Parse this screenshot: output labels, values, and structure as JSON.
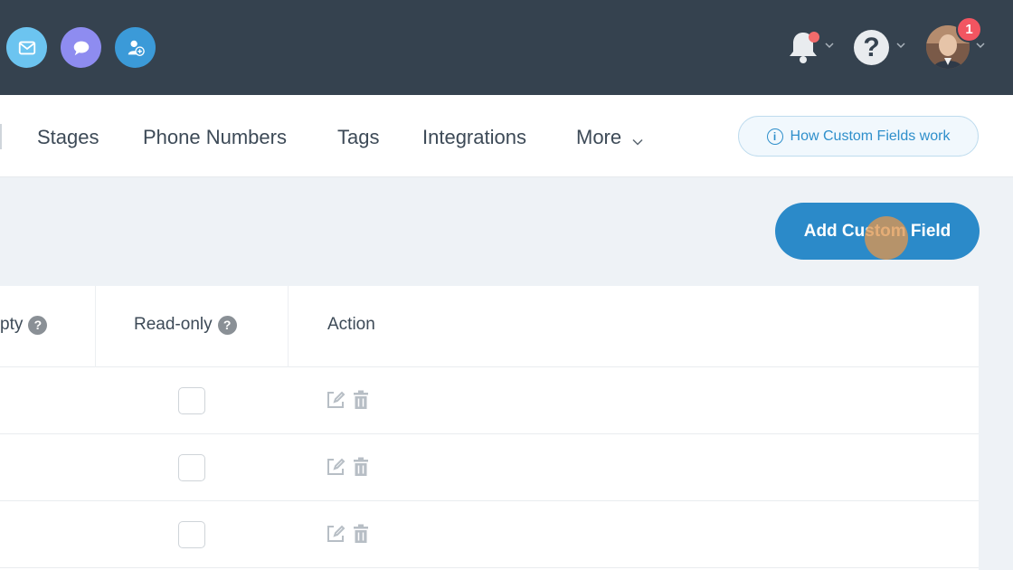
{
  "topbar": {
    "icons": [
      "mail-icon",
      "chat-icon",
      "add-user-icon"
    ],
    "notification_icon": "bell-icon",
    "help_icon": "help-icon",
    "help_glyph": "?",
    "profile_badge": "1"
  },
  "nav": {
    "items": [
      "Stages",
      "Phone Numbers",
      "Tags",
      "Integrations",
      "More"
    ],
    "help_link": "How Custom Fields work"
  },
  "actions": {
    "add_button": "Add Custom Field"
  },
  "table": {
    "columns": [
      "pty",
      "Read-only",
      "Action"
    ],
    "help_glyph": "?",
    "rows": [
      {
        "read_only": false
      },
      {
        "read_only": false
      },
      {
        "read_only": false
      }
    ]
  },
  "colors": {
    "topbar": "#35424f",
    "accent": "#2b8ac9",
    "badge": "#f25561"
  }
}
